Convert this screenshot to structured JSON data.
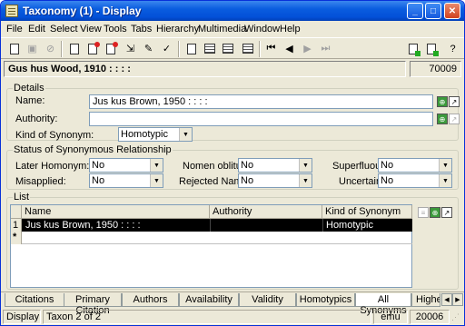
{
  "window": {
    "title": "Taxonomy (1) - Display"
  },
  "menu": [
    "File",
    "Edit",
    "Select",
    "View",
    "Tools",
    "Tabs",
    "Hierarchy",
    "Multimedia",
    "Window",
    "Help"
  ],
  "record": {
    "title": "Gus hus Wood, 1910 : : : :",
    "id": "70009"
  },
  "details": {
    "legend": "Details",
    "name_label": "Name:",
    "name_value": "Jus kus Brown, 1950 : : : :",
    "authority_label": "Authority:",
    "authority_value": "",
    "kind_label": "Kind of Synonym:",
    "kind_value": "Homotypic"
  },
  "status": {
    "legend": "Status of Synonymous Relationship",
    "later_homonym_label": "Later Homonym:",
    "later_homonym_value": "No",
    "nomen_oblitum_label": "Nomen oblitum:",
    "nomen_oblitum_value": "No",
    "superfluous_label": "Superfluous:",
    "superfluous_value": "No",
    "misapplied_label": "Misapplied:",
    "misapplied_value": "No",
    "rejected_name_label": "Rejected Name:",
    "rejected_name_value": "No",
    "uncertain_label": "Uncertain:",
    "uncertain_value": "No"
  },
  "list": {
    "legend": "List",
    "columns": [
      "Name",
      "Authority",
      "Kind of Synonym"
    ],
    "rows": [
      {
        "num": "1",
        "name": "Jus kus Brown, 1950 : : : :",
        "authority": "",
        "kind": "Homotypic"
      }
    ],
    "new_row_marker": "*"
  },
  "tabs": [
    "Citations",
    "Primary Citation",
    "Authors",
    "Availability",
    "Validity",
    "Homotypics",
    "All Synonyms",
    "Highe"
  ],
  "active_tab": "All Synonyms",
  "statusbar": {
    "mode": "Display",
    "position": "Taxon 2 of 2",
    "user": "emu",
    "count": "20006"
  }
}
